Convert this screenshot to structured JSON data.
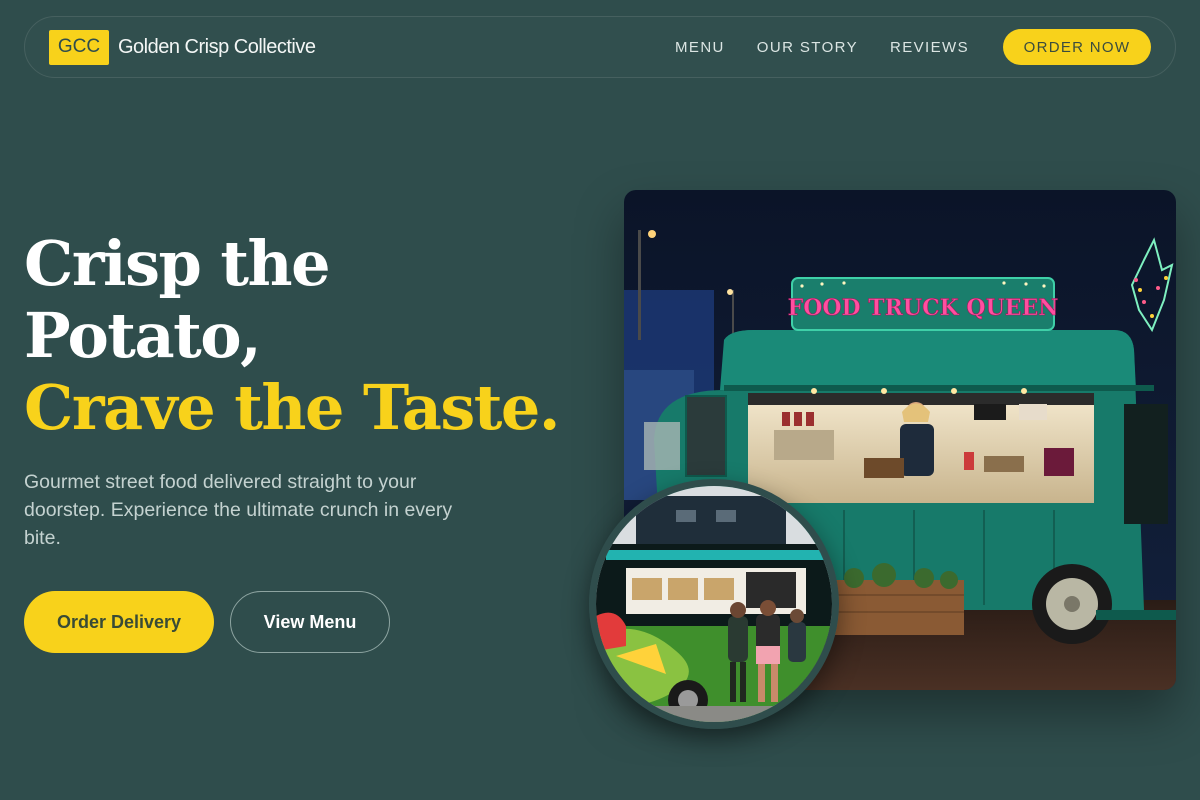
{
  "brand": {
    "badge": "GCC",
    "name": "Golden Crisp Collective"
  },
  "nav": {
    "links": [
      "MENU",
      "OUR STORY",
      "REVIEWS"
    ],
    "cta": "ORDER NOW"
  },
  "hero": {
    "title_line1": "Crisp the",
    "title_line2": "Potato,",
    "title_accent": "Crave the Taste.",
    "subtitle": "Gourmet street food delivered straight to your doorstep. Experience the ultimate crunch in every bite.",
    "primary_button": "Order Delivery",
    "secondary_button": "View Menu"
  },
  "images": {
    "main_sign": "FOOD TRUCK QUEEN",
    "main_alt_icon": "food-truck-photo",
    "circle_alt_icon": "food-truck-side-photo"
  },
  "colors": {
    "background": "#2f4d4c",
    "accent": "#f8d21b",
    "text": "#ffffff",
    "muted_text": "#c4d2d0"
  }
}
